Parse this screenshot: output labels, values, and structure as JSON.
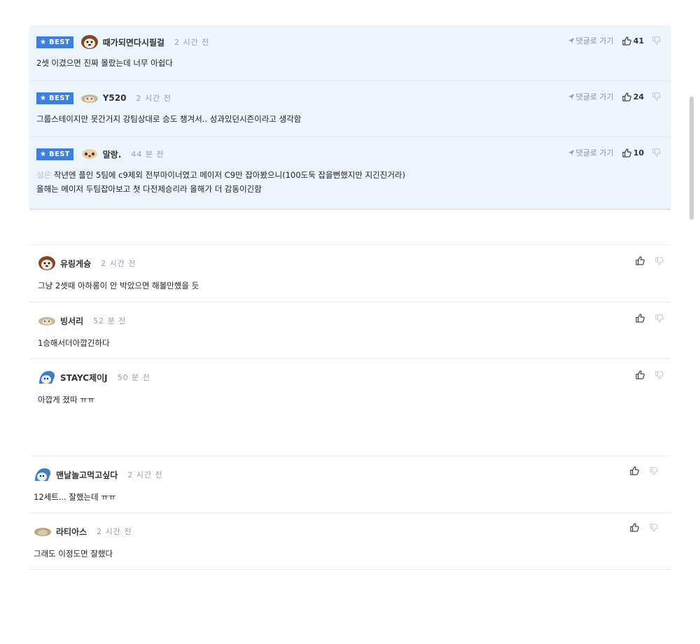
{
  "best_label": "★ BEST",
  "reply_link_label": "댓글로 가기",
  "best_comments": [
    {
      "nick": "때가되면다시필걸",
      "time": "2 시간 전",
      "text": "2셋 이겼으면 진짜 몰랐는데 너무 아쉽다",
      "likes": "41"
    },
    {
      "nick": "Y520",
      "time": "2 시간 전",
      "text": "그룹스테이지만 못간거지 강팀상대로 승도 챙겨서.. 성과있던시즌이라고 생각함",
      "likes": "24"
    },
    {
      "nick": "말랑.",
      "time": "44 분 전",
      "text_prefix": "설은",
      "text": "작년엔 플인 5팀에 c9제외 전부마이너였고 메이저 C9만 잡아봤으니(100도둑 잡을뻔했지만 지긴진거라)",
      "text2": "올해는 메이저 두팀잡아보고 첫 다전제승리라 올해가 더 감동이긴함",
      "likes": "10"
    }
  ],
  "group1": [
    {
      "nick": "유링게슝",
      "time": "2 시간 전",
      "text": "그냥 2셋때 아하롱이 안 박았으면 해볼만했을 듯"
    },
    {
      "nick": "빙서리",
      "time": "52 분 전",
      "text": "1승해서더아깝긴하다"
    },
    {
      "nick": "STAYC제이J",
      "time": "50 분 전",
      "text": "아깝게 졌따 ㅠㅠ"
    }
  ],
  "group2": [
    {
      "nick": "맨날놀고먹고싶다",
      "time": "2 시간 전",
      "text": "12세트... 잘했는데 ㅠㅠ"
    },
    {
      "nick": "라티아스",
      "time": "2 시간 전",
      "text": "그래도 이정도면 잘했다"
    }
  ]
}
